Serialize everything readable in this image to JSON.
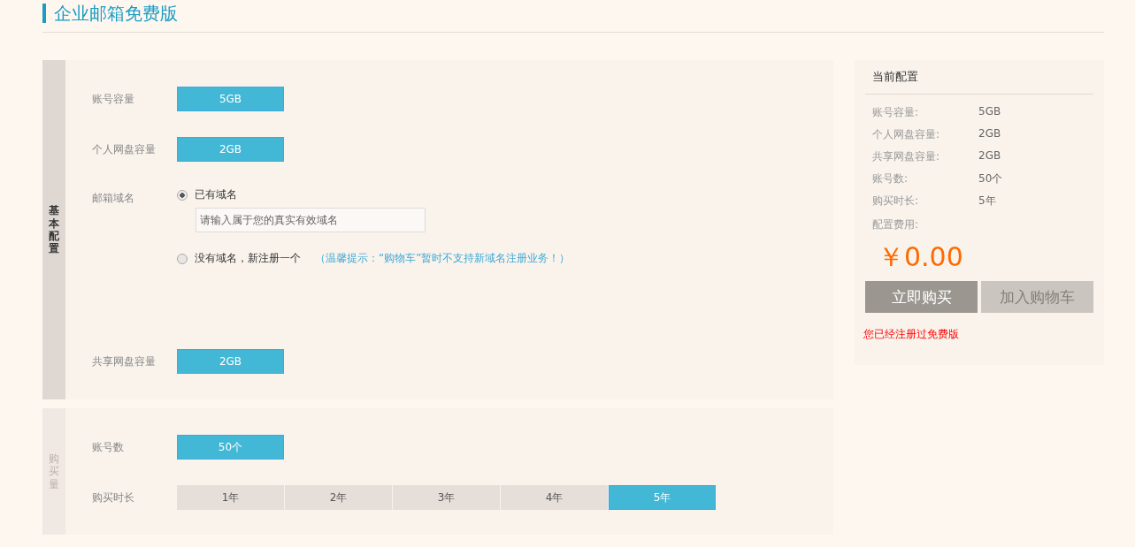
{
  "page_title": "企业邮箱免费版",
  "sections": [
    {
      "tab": "基本配置",
      "active": true,
      "rows": [
        {
          "kind": "option",
          "label": "账号容量",
          "options": [
            {
              "label": "5GB",
              "selected": true
            }
          ]
        },
        {
          "kind": "option",
          "label": "个人网盘容量",
          "options": [
            {
              "label": "2GB",
              "selected": true
            }
          ]
        },
        {
          "kind": "domain",
          "label": "邮箱域名",
          "choices": [
            {
              "label": "已有域名",
              "selected": true,
              "placeholder": "请输入属于您的真实有效域名"
            },
            {
              "label": "没有域名，新注册一个",
              "selected": false,
              "hint": "（温馨提示：“购物车”暂时不支持新域名注册业务！）"
            }
          ]
        },
        {
          "kind": "option",
          "label": "共享网盘容量",
          "options": [
            {
              "label": "2GB",
              "selected": true
            }
          ]
        }
      ]
    },
    {
      "tab": "购买量",
      "active": false,
      "rows": [
        {
          "kind": "option",
          "label": "账号数",
          "options": [
            {
              "label": "50个",
              "selected": true
            }
          ]
        },
        {
          "kind": "option",
          "label": "购买时长",
          "options": [
            {
              "label": "1年",
              "selected": false
            },
            {
              "label": "2年",
              "selected": false
            },
            {
              "label": "3年",
              "selected": false
            },
            {
              "label": "4年",
              "selected": false
            },
            {
              "label": "5年",
              "selected": true
            }
          ]
        }
      ]
    }
  ],
  "summary": {
    "title": "当前配置",
    "items": [
      {
        "label": "账号容量:",
        "value": "5GB"
      },
      {
        "label": "个人网盘容量:",
        "value": "2GB"
      },
      {
        "label": "共享网盘容量:",
        "value": "2GB"
      },
      {
        "label": "账号数:",
        "value": "50个"
      },
      {
        "label": "购买时长:",
        "value": "5年"
      }
    ],
    "fee_label": "配置费用:",
    "price": "￥0.00",
    "buttons": [
      {
        "label": "立即购买",
        "disabled": false
      },
      {
        "label": "加入购物车",
        "disabled": true
      }
    ],
    "notice": "您已经注册过免费版"
  }
}
